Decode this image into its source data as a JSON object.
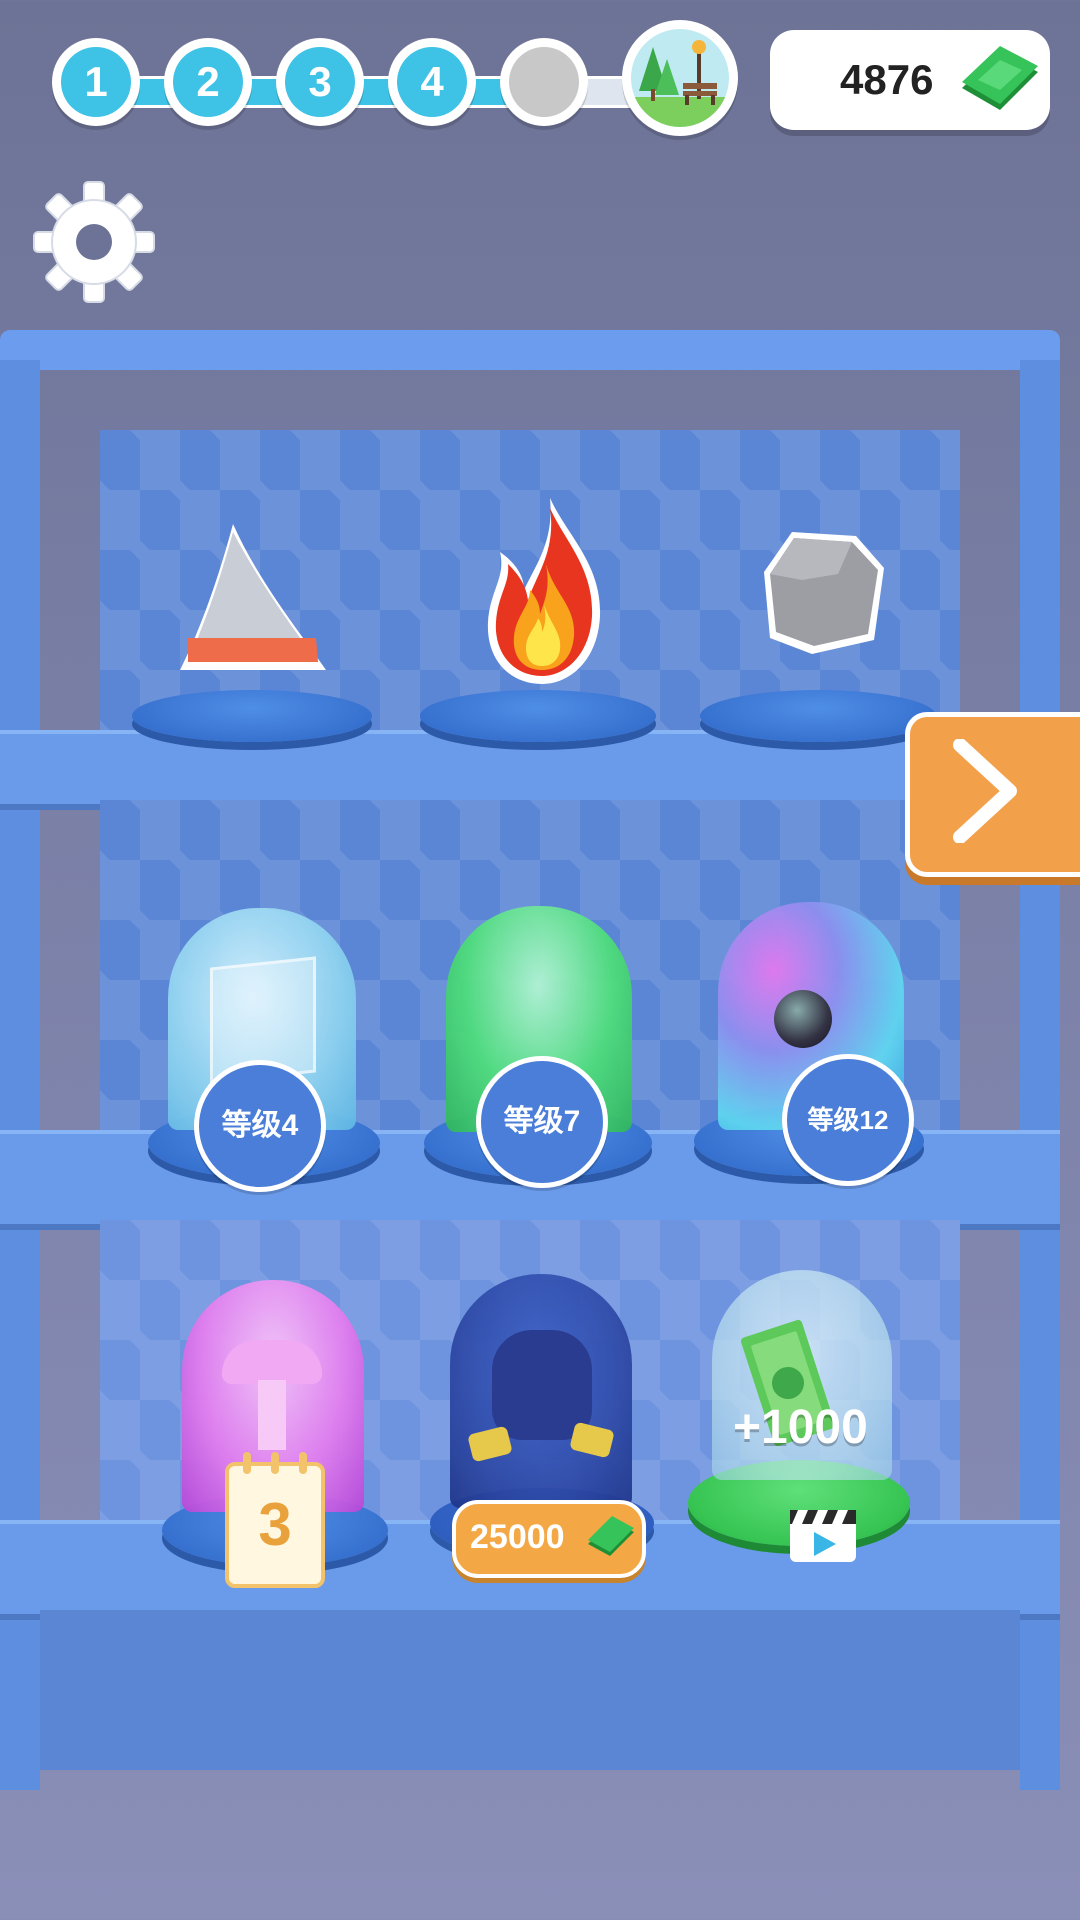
{
  "progress": {
    "steps": [
      {
        "label": "1",
        "done": true
      },
      {
        "label": "2",
        "done": true
      },
      {
        "label": "3",
        "done": true
      },
      {
        "label": "4",
        "done": true
      },
      {
        "label": "",
        "done": false
      }
    ],
    "goal_icon": "park-bench-icon"
  },
  "currency": {
    "amount": "4876",
    "icon": "cash-icon",
    "color": "#2fb84a"
  },
  "settings": {
    "icon": "gear-icon"
  },
  "shelf": {
    "top_row": [
      {
        "name": "shark-fin",
        "icon": "shark-fin-icon"
      },
      {
        "name": "fire",
        "icon": "fire-icon"
      },
      {
        "name": "rock",
        "icon": "rock-icon"
      }
    ],
    "middle_row": [
      {
        "name": "ice-dome",
        "level": "等级4",
        "color": "#8fd4f0"
      },
      {
        "name": "slime-dome",
        "level": "等级7",
        "color": "#4fe07a"
      },
      {
        "name": "galaxy-dome",
        "level": "等级12",
        "color": "#5fd8f0"
      }
    ],
    "bottom_row": [
      {
        "name": "mushroom-dome",
        "days": "3",
        "color": "#e77ff0"
      },
      {
        "name": "monster-dome",
        "price": "25000",
        "color": "#2e4aa8"
      },
      {
        "name": "cash-dome",
        "reward": "+1000",
        "color": "#bfe6ef"
      }
    ]
  },
  "next_button": {
    "icon": "chevron-right-icon",
    "color": "#f3a04a"
  }
}
